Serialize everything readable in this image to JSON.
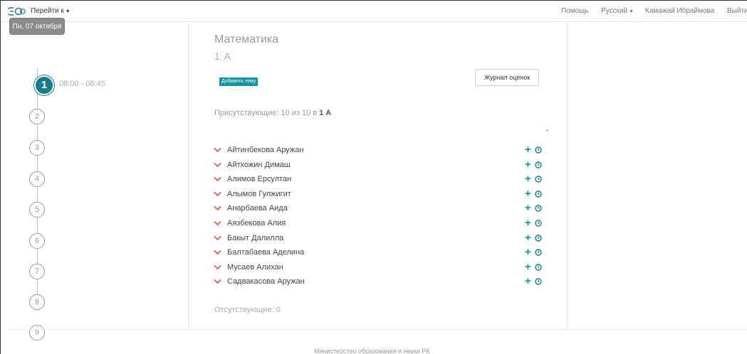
{
  "nav": {
    "goto_label": "Перейти к",
    "help": "Помощь",
    "language": "Русский",
    "user": "Камажай Ибраймова",
    "logout": "Выйти"
  },
  "schedule": {
    "date": "Пн, 07 октября",
    "active_time": "08:00 - 08:45",
    "lessons": [
      "1",
      "2",
      "3",
      "4",
      "5",
      "6",
      "7",
      "8",
      "9"
    ]
  },
  "lesson": {
    "subject": "Математика",
    "class": "1 А",
    "add_topic": "Добавить тему",
    "journal": "Журнал оценок",
    "present_prefix": "Присутствующие: 10 из 10 в ",
    "present_class": "1 А",
    "absent": "Отсутствующие: 0"
  },
  "students": [
    "Айтинбекова Аружан",
    "Айтхожин Димаш",
    "Алимов Ерсултан",
    "Алымов Гулжигит",
    "Анарбаева Аида",
    "Аязбекова Алия",
    "Бакыт Далилла",
    "Балтабаева Аделина",
    "Мусаев Алихан",
    "Садвакасова Аружан"
  ],
  "footer": "Министерство образования и науки РК",
  "colors": {
    "accent": "#167e8a",
    "chevron": "#e05a5a",
    "chip": "#8b8b8b"
  }
}
